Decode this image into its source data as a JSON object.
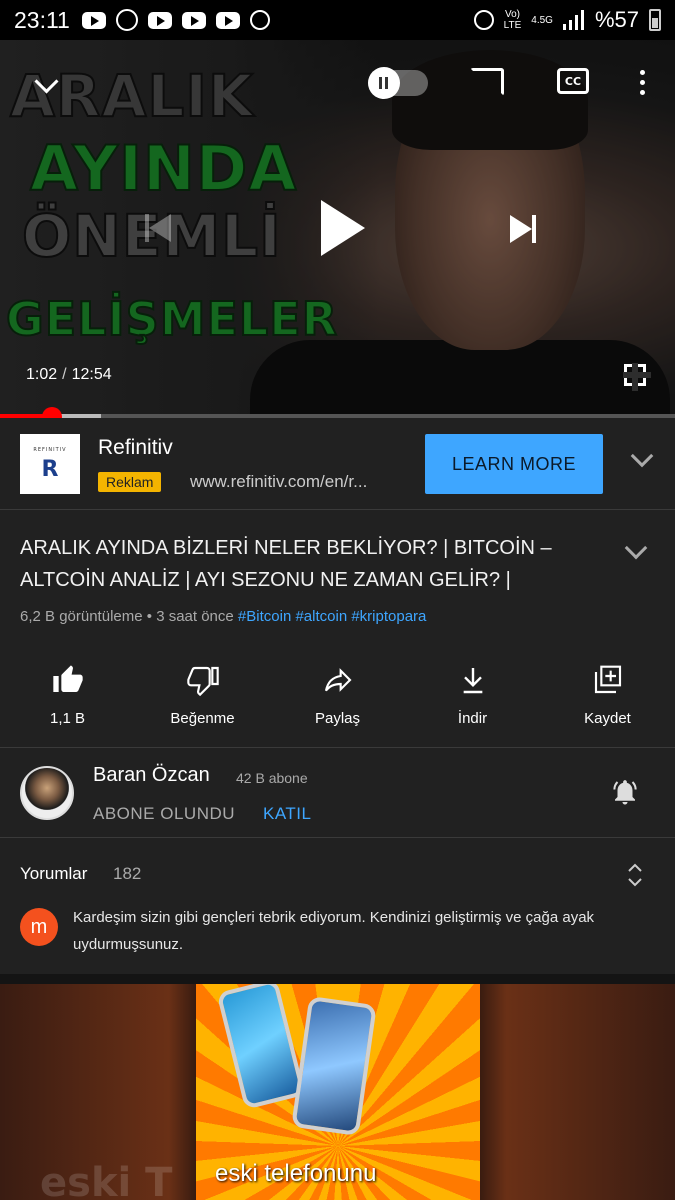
{
  "status_bar": {
    "time": "23:11",
    "battery": "%57",
    "network": "LTE",
    "speed": "4.5G"
  },
  "player": {
    "thumbnail_lines": [
      "ARALIK",
      "AYINDA",
      "ÖNEMLİ",
      "GELİŞMELER"
    ],
    "current_time": "1:02",
    "time_separator": "/",
    "duration": "12:54",
    "progress_fraction": 0.08,
    "buffered_fraction": 0.15,
    "cc_label": "CC"
  },
  "ad": {
    "logo_text": "REFINITIV",
    "logo_mark": "R",
    "advertiser": "Refinitiv",
    "badge": "Reklam",
    "url": "www.refinitiv.com/en/r...",
    "cta": "LEARN MORE"
  },
  "video": {
    "title": "ARALIK AYINDA BİZLERİ NELER BEKLİYOR? | BITCOİN – ALTCOİN ANALİZ | AYI SEZONU NE ZAMAN GELİR? |",
    "views": "6,2 B görüntüleme",
    "dot": "•",
    "age": "3 saat önce",
    "hashtags": [
      "#Bitcoin",
      "#altcoin",
      "#kriptopara"
    ]
  },
  "actions": [
    {
      "label": "1,1 B",
      "icon": "thumbs-up-icon"
    },
    {
      "label": "Beğenme",
      "icon": "thumbs-down-icon"
    },
    {
      "label": "Paylaş",
      "icon": "share-icon"
    },
    {
      "label": "İndir",
      "icon": "download-icon"
    },
    {
      "label": "Kaydet",
      "icon": "save-playlist-icon"
    }
  ],
  "channel": {
    "name": "Baran Özcan",
    "subscribers": "42 B abone",
    "subscribed_label": "ABONE OLUNDU",
    "join_label": "KATIL"
  },
  "comments": {
    "label": "Yorumlar",
    "count": "182",
    "top_comment_initial": "m",
    "top_comment": "Kardeşim sizin gibi gençleri tebrik ediyorum. Kendinizi geliştirmiş ve çağa ayak uydurmuşsunuz."
  },
  "promo": {
    "caption": "eski telefonunu",
    "faded_text": "eski T"
  },
  "colors": {
    "accent_blue": "#3ea6ff",
    "progress_red": "#ff0000",
    "badge_yellow": "#f4b400",
    "background": "#212121"
  }
}
